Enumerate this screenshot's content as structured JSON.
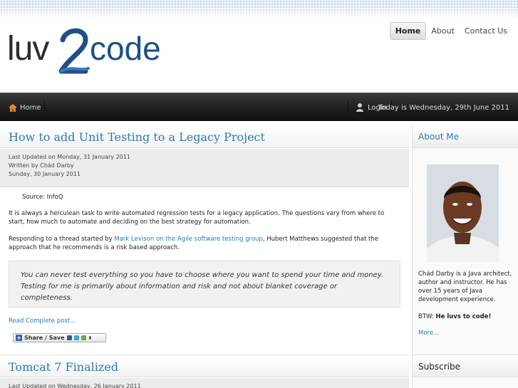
{
  "site": {
    "logo_text": "luv2code"
  },
  "top_nav": {
    "items": [
      {
        "label": "Home"
      },
      {
        "label": "About"
      },
      {
        "label": "Contact Us"
      }
    ]
  },
  "bar": {
    "home_label": "Home",
    "login_label": "Login",
    "date_text": "Today is Wednesday, 29th June 2011"
  },
  "post1": {
    "title": "How to add Unit Testing to a Legacy Project",
    "updated": "Last Updated on Monday, 31 January 2011",
    "author": "Written by Chád Darby",
    "date": "Sunday, 30 January 2011",
    "source": "Source: InfoQ",
    "para1": "It is always a herculean task to write automated regression tests for a legacy application. The questions vary from where to start, how much to automate and deciding on the best strategy for automation.",
    "para2_pre": "Responding to a thread started by ",
    "para2_link": "Mark Levison on the Agile software testing group",
    "para2_post": ", Hubert Matthews suggested that the approach that he recommends is a risk based approach.",
    "quote": "You can never test everything so you have to choose where you want to spend your time and money. Testing for me is primarily about information and risk and not about blanket coverage or completeness.",
    "read_more": "Read Complete post...",
    "share_label": "Share / Save"
  },
  "post2": {
    "title": "Tomcat 7 Finalized",
    "updated": "Last Updated on Wednesday, 26 January 2011"
  },
  "sidebar": {
    "about_heading": "About Me",
    "bio": "Chád Darby is a Java architect, author and instructor. He has over 15 years of Java development experience.",
    "btw_pre": "BTW: ",
    "btw_bold": "He luvs to code!",
    "more_link": "More...",
    "subscribe_heading": "Subscribe"
  },
  "colors": {
    "link": "#2a7ab8",
    "bar": "#1f1f1f"
  }
}
